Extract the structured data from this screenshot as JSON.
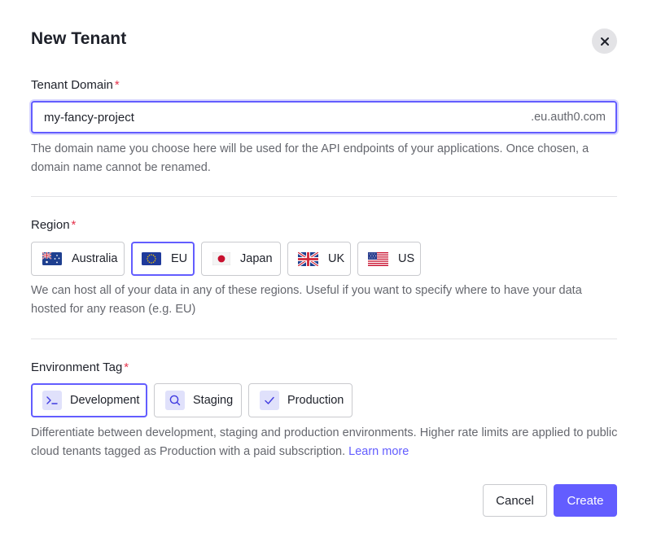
{
  "dialog": {
    "title": "New Tenant",
    "close_icon": "close-icon"
  },
  "domain": {
    "label": "Tenant Domain",
    "required_mark": "*",
    "value": "my-fancy-project",
    "suffix": ".eu.auth0.com",
    "help": "The domain name you choose here will be used for the API endpoints of your applications. Once chosen, a domain name cannot be renamed."
  },
  "region": {
    "label": "Region",
    "required_mark": "*",
    "options": [
      {
        "label": "Australia",
        "icon": "australia-flag-icon",
        "selected": false
      },
      {
        "label": "EU",
        "icon": "eu-flag-icon",
        "selected": true
      },
      {
        "label": "Japan",
        "icon": "japan-flag-icon",
        "selected": false
      },
      {
        "label": "UK",
        "icon": "uk-flag-icon",
        "selected": false
      },
      {
        "label": "US",
        "icon": "us-flag-icon",
        "selected": false
      }
    ],
    "help": "We can host all of your data in any of these regions. Useful if you want to specify where to have your data hosted for any reason (e.g. EU)"
  },
  "environment": {
    "label": "Environment Tag",
    "required_mark": "*",
    "options": [
      {
        "label": "Development",
        "icon": "terminal-icon",
        "selected": true
      },
      {
        "label": "Staging",
        "icon": "search-icon",
        "selected": false
      },
      {
        "label": "Production",
        "icon": "checkmark-icon",
        "selected": false
      }
    ],
    "help": "Differentiate between development, staging and production environments. Higher rate limits are applied to public cloud tenants tagged as Production with a paid subscription.",
    "learn_more": "Learn more"
  },
  "actions": {
    "cancel": "Cancel",
    "create": "Create"
  },
  "colors": {
    "accent": "#635dff",
    "required": "#e5334c",
    "muted_text": "#65676e",
    "border": "#c9cace"
  }
}
